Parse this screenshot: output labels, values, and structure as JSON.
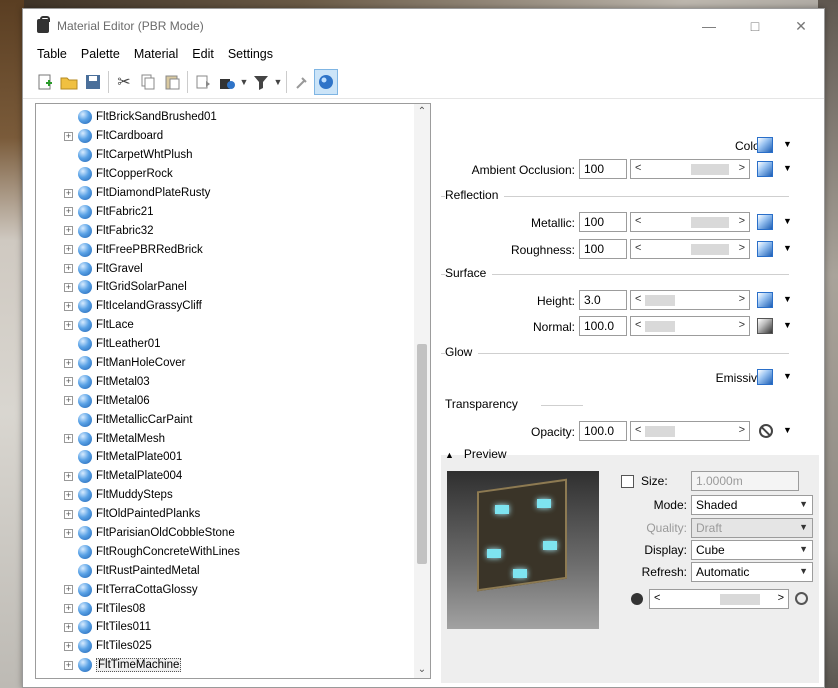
{
  "window": {
    "title": "Material Editor (PBR Mode)"
  },
  "menu": [
    "Table",
    "Palette",
    "Material",
    "Edit",
    "Settings"
  ],
  "tree": {
    "items": [
      {
        "label": "FltBrickSandBrushed01",
        "expand": false
      },
      {
        "label": "FltCardboard",
        "expand": true
      },
      {
        "label": "FltCarpetWhtPlush",
        "expand": false
      },
      {
        "label": "FltCopperRock",
        "expand": false
      },
      {
        "label": "FltDiamondPlateRusty",
        "expand": true
      },
      {
        "label": "FltFabric21",
        "expand": true
      },
      {
        "label": "FltFabric32",
        "expand": true
      },
      {
        "label": "FltFreePBRRedBrick",
        "expand": true
      },
      {
        "label": "FltGravel",
        "expand": true
      },
      {
        "label": "FltGridSolarPanel",
        "expand": true
      },
      {
        "label": "FltIcelandGrassyCliff",
        "expand": true
      },
      {
        "label": "FltLace",
        "expand": true
      },
      {
        "label": "FltLeather01",
        "expand": false
      },
      {
        "label": "FltManHoleCover",
        "expand": true
      },
      {
        "label": "FltMetal03",
        "expand": true
      },
      {
        "label": "FltMetal06",
        "expand": true
      },
      {
        "label": "FltMetallicCarPaint",
        "expand": false
      },
      {
        "label": "FltMetalMesh",
        "expand": true
      },
      {
        "label": "FltMetalPlate001",
        "expand": false
      },
      {
        "label": "FltMetalPlate004",
        "expand": true
      },
      {
        "label": "FltMuddySteps",
        "expand": true
      },
      {
        "label": "FltOldPaintedPlanks",
        "expand": true
      },
      {
        "label": "FltParisianOldCobbleStone",
        "expand": true
      },
      {
        "label": "FltRoughConcreteWithLines",
        "expand": false
      },
      {
        "label": "FltRustPaintedMetal",
        "expand": false
      },
      {
        "label": "FltTerraCottaGlossy",
        "expand": true
      },
      {
        "label": "FltTiles08",
        "expand": true
      },
      {
        "label": "FltTiles011",
        "expand": true
      },
      {
        "label": "FltTiles025",
        "expand": true
      },
      {
        "label": "FltTimeMachine",
        "expand": true,
        "selected": true
      }
    ]
  },
  "props": {
    "color_label": "Color:",
    "ao_label": "Ambient Occlusion:",
    "ao_value": "100",
    "reflection_section": "Reflection",
    "metallic_label": "Metallic:",
    "metallic_value": "100",
    "roughness_label": "Roughness:",
    "roughness_value": "100",
    "surface_section": "Surface",
    "height_label": "Height:",
    "height_value": "3.0",
    "normal_label": "Normal:",
    "normal_value": "100.0",
    "glow_section": "Glow",
    "emissive_label": "Emissive:",
    "transparency_section": "Transparency",
    "opacity_label": "Opacity:",
    "opacity_value": "100.0"
  },
  "preview": {
    "header": "Preview",
    "size_label": "Size:",
    "size_value": "1.0000m",
    "mode_label": "Mode:",
    "mode_value": "Shaded",
    "quality_label": "Quality:",
    "quality_value": "Draft",
    "display_label": "Display:",
    "display_value": "Cube",
    "refresh_label": "Refresh:",
    "refresh_value": "Automatic"
  }
}
